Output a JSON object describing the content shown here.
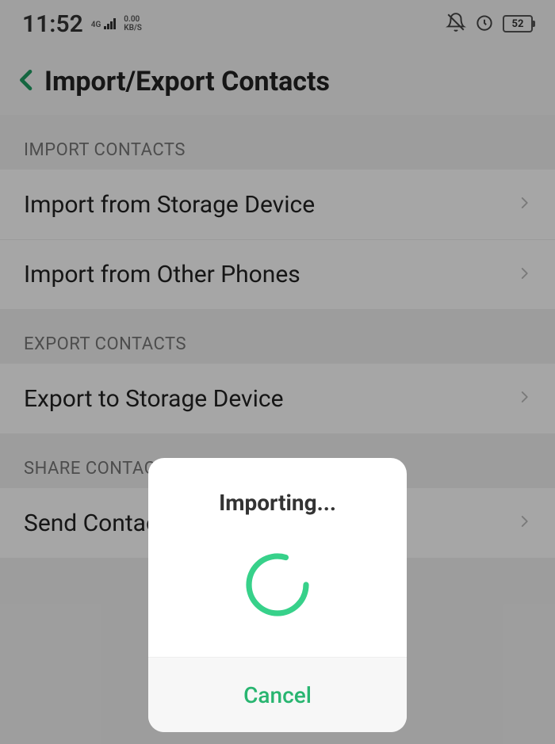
{
  "statusbar": {
    "time": "11:52",
    "network_gen": "4G",
    "speed_value": "0.00",
    "speed_unit": "KB/S",
    "battery_pct": "52"
  },
  "header": {
    "title": "Import/Export Contacts"
  },
  "sections": {
    "import_header": "IMPORT CONTACTS",
    "import_storage": "Import from Storage Device",
    "import_phones": "Import from Other Phones",
    "export_header": "EXPORT CONTACTS",
    "export_storage": "Export to Storage Device",
    "share_header": "SHARE CONTACTS",
    "send_contacts": "Send Contacts"
  },
  "dialog": {
    "title": "Importing...",
    "cancel": "Cancel"
  },
  "colors": {
    "accent": "#28b570"
  }
}
